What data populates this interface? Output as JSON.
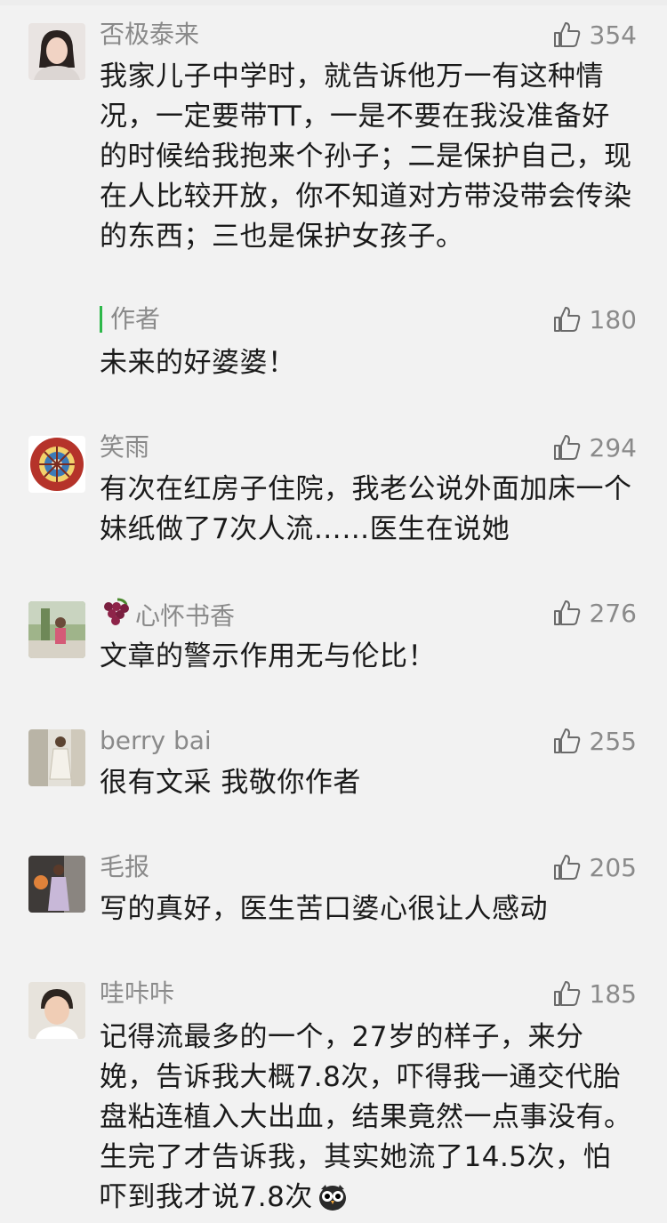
{
  "comments": [
    {
      "name": "否极泰来",
      "likes": "354",
      "body": "我家儿子中学时，就告诉他万一有这种情况，一定要带TT，一是不要在我没准备好的时候给我抱来个孙子；二是保护自己，现在人比较开放，你不知道对方带没带会传染的东西；三也是保护女孩子。",
      "reply": {
        "name": "作者",
        "likes": "180",
        "body": "未来的好婆婆！"
      }
    },
    {
      "name": "笑雨",
      "likes": "294",
      "body": "有次在红房子住院，我老公说外面加床一个妹纸做了7次人流……医生在说她"
    },
    {
      "name": "心怀书香",
      "name_emoji": "grapes-emoji",
      "likes": "276",
      "body": "文章的警示作用无与伦比！"
    },
    {
      "name": "berry bai",
      "likes": "255",
      "body": "很有文采 我敬你作者"
    },
    {
      "name": "毛报",
      "likes": "205",
      "body": "写的真好，医生苦口婆心很让人感动"
    },
    {
      "name": "哇咔咔",
      "likes": "185",
      "body": "记得流最多的一个，27岁的样子，来分娩，告诉我大概7.8次，吓得我一通交代胎盘粘连植入大出血，结果竟然一点事没有。生完了才告诉我，其实她流了14.5次，怕吓到我才说7.8次",
      "body_emoji": "owl-emoji"
    }
  ],
  "colors": {
    "background": "#f2f2f2",
    "meta": "#8a8a8a",
    "text": "#1a1a1a",
    "reply_bar": "#2eb84a"
  }
}
